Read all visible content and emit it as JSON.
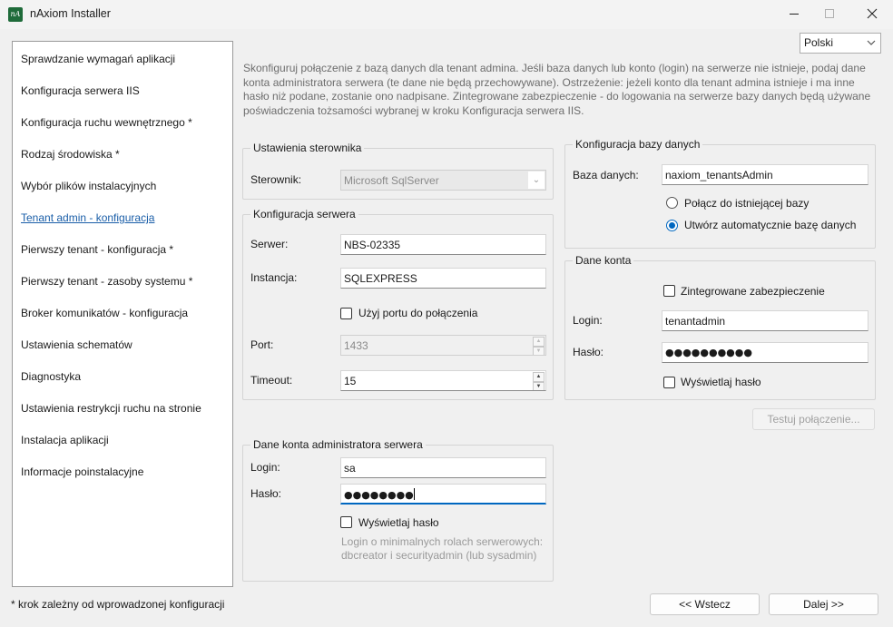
{
  "window": {
    "title": "nAxiom Installer",
    "app_icon_text": "nA"
  },
  "sidebar": {
    "items": [
      {
        "label": "Sprawdzanie wymagań aplikacji"
      },
      {
        "label": "Konfiguracja serwera IIS"
      },
      {
        "label": "Konfiguracja ruchu wewnętrznego *"
      },
      {
        "label": "Rodzaj środowiska *"
      },
      {
        "label": "Wybór plików instalacyjnych"
      },
      {
        "label": "Tenant admin - konfiguracja",
        "active": true
      },
      {
        "label": "Pierwszy tenant - konfiguracja *"
      },
      {
        "label": "Pierwszy tenant - zasoby systemu *"
      },
      {
        "label": "Broker komunikatów - konfiguracja"
      },
      {
        "label": "Ustawienia schematów"
      },
      {
        "label": "Diagnostyka"
      },
      {
        "label": "Ustawienia restrykcji ruchu na stronie"
      },
      {
        "label": "Instalacja aplikacji"
      },
      {
        "label": "Informacje poinstalacyjne"
      }
    ],
    "footnote": "* krok zależny od wprowadzonej konfiguracji"
  },
  "language": {
    "selected": "Polski"
  },
  "description": "Skonfiguruj połączenie z bazą danych dla tenant admina. Jeśli baza danych lub konto (login) na serwerze nie istnieje, podaj dane konta administratora serwera (te dane nie będą przechowywane). Ostrzeżenie: jeżeli konto dla tenant admina istnieje i ma inne hasło niż podane, zostanie ono nadpisane.  Zintegrowane zabezpieczenie - do logowania na serwerze bazy danych będą używane poświadczenia tożsamości wybranej w kroku Konfiguracja serwera IIS.",
  "driver_settings": {
    "title": "Ustawienia sterownika",
    "driver_label": "Sterownik:",
    "driver_value": "Microsoft SqlServer"
  },
  "server_config": {
    "title": "Konfiguracja serwera",
    "server_label": "Serwer:",
    "server_value": "NBS-02335",
    "instance_label": "Instancja:",
    "instance_value": "SQLEXPRESS",
    "use_port_label": "Użyj portu do połączenia",
    "port_label": "Port:",
    "port_value": "1433",
    "timeout_label": "Timeout:",
    "timeout_value": "15"
  },
  "admin_account": {
    "title": "Dane konta administratora serwera",
    "login_label": "Login:",
    "login_value": "sa",
    "password_label": "Hasło:",
    "password_value": "●●●●●●●●",
    "show_password_label": "Wyświetlaj hasło",
    "hint": "Login o minimalnych rolach serwerowych: dbcreator i securityadmin (lub sysadmin)"
  },
  "db_config": {
    "title": "Konfiguracja bazy danych",
    "database_label": "Baza danych:",
    "database_value": "naxiom_tenantsAdmin",
    "connect_existing_label": "Połącz do istniejącej bazy",
    "create_auto_label": "Utwórz automatycznie bazę danych",
    "selected": "create_auto"
  },
  "account_data": {
    "title": "Dane konta",
    "integrated_security_label": "Zintegrowane zabezpieczenie",
    "login_label": "Login:",
    "login_value": "tenantadmin",
    "password_label": "Hasło:",
    "password_value": "●●●●●●●●●●",
    "show_password_label": "Wyświetlaj hasło"
  },
  "buttons": {
    "test_connection": "Testuj połączenie...",
    "back": "<< Wstecz",
    "next": "Dalej >>"
  }
}
